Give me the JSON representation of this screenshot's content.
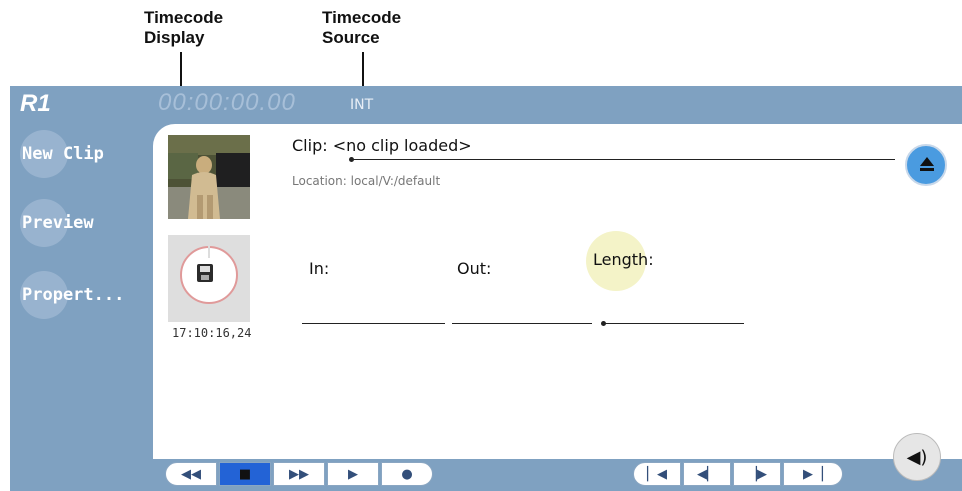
{
  "callouts": {
    "timecode_display": [
      "Timecode",
      "Display"
    ],
    "timecode_source": [
      "Timecode",
      "Source"
    ]
  },
  "header": {
    "recorder_name": "R1",
    "timecode": "00:00:00.00",
    "timecode_source": "INT"
  },
  "sidebar": {
    "items": [
      {
        "label": "New Clip"
      },
      {
        "label": "Preview"
      },
      {
        "label": "Propert..."
      }
    ]
  },
  "clip": {
    "label": "Clip:",
    "value": "<no clip loaded>",
    "location": "Location: local/V:/default"
  },
  "record": {
    "timestamp": "17:10:16,24"
  },
  "fields": {
    "in_label": "In:",
    "out_label": "Out:",
    "length_label": "Length:"
  },
  "transport": {
    "left_group": [
      "rewind-icon",
      "stop-icon",
      "fast-forward-icon",
      "play-icon",
      "record-icon"
    ],
    "right_group": [
      "go-to-start-icon",
      "step-back-icon",
      "step-forward-icon",
      "go-to-end-icon"
    ],
    "active": "stop-icon"
  },
  "icons": {
    "eject": "eject-icon",
    "save": "floppy-disk-icon",
    "audio": "speaker-icon"
  },
  "colors": {
    "frame_blue": "#7fa1c1",
    "eject_blue": "#4a9be0",
    "active_button": "#2363d6",
    "length_highlight": "#f4f3c8"
  }
}
